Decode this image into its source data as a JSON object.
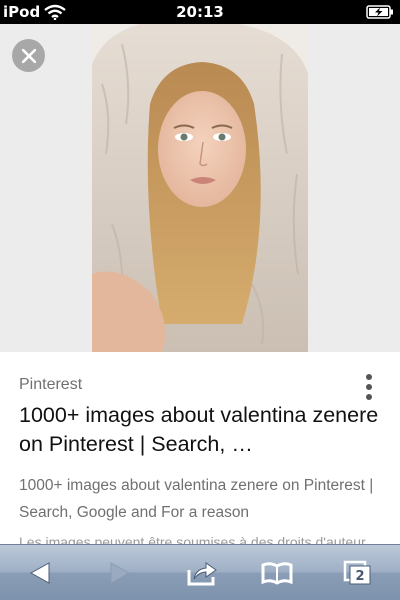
{
  "status_bar": {
    "carrier": "iPod",
    "time": "20:13",
    "wifi_icon": "wifi-icon",
    "battery_icon": "battery-charging-icon"
  },
  "viewer": {
    "close_icon": "close-icon",
    "image_alt": "woman-in-fluffy-hooded-robe"
  },
  "result": {
    "source": "Pinterest",
    "title": "1000+ images about valentina zenere on Pinterest | Search, …",
    "snippet": "1000+ images about valentina zenere on Pinterest | Search, Google and For a reason",
    "notice": "Les images peuvent être soumises à des droits d'auteur",
    "menu_icon": "more-vertical-icon"
  },
  "toolbar": {
    "back_icon": "back-arrow-icon",
    "forward_icon": "forward-arrow-icon",
    "share_icon": "share-icon",
    "bookmarks_icon": "bookmarks-icon",
    "tabs_icon": "tabs-icon",
    "tab_count": "2"
  },
  "colors": {
    "toolbar_top": "#bcc8d8",
    "toolbar_bottom": "#7d92ad",
    "viewer_bg": "#ececec",
    "title_text": "#111111",
    "secondary_text": "#707070"
  }
}
